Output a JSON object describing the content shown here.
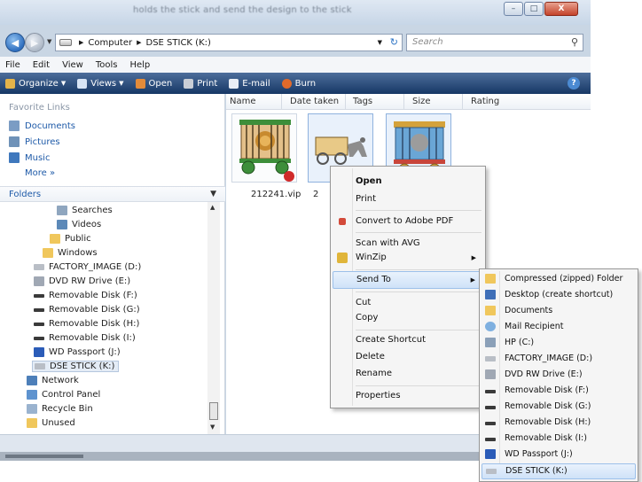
{
  "window": {
    "title": "holds the stick and send the design to the stick",
    "caption_buttons": {
      "minimize": "–",
      "maximize": "□",
      "close": "X"
    }
  },
  "address": {
    "path": [
      "Computer",
      "DSE STICK (K:)"
    ],
    "search_placeholder": "Search"
  },
  "menubar": {
    "items": [
      "File",
      "Edit",
      "View",
      "Tools",
      "Help"
    ]
  },
  "command_bar": {
    "items": [
      {
        "label": "Organize",
        "icon": "organize-icon",
        "dropdown": true
      },
      {
        "label": "Views",
        "icon": "views-icon",
        "dropdown": true
      },
      {
        "label": "Open",
        "icon": "open-icon",
        "dropdown": false
      },
      {
        "label": "Print",
        "icon": "printer-icon",
        "dropdown": false
      },
      {
        "label": "E-mail",
        "icon": "email-icon",
        "dropdown": false
      },
      {
        "label": "Burn",
        "icon": "burn-icon",
        "dropdown": false
      }
    ]
  },
  "nav": {
    "favorites_heading": "Favorite Links",
    "favorites": [
      {
        "label": "Documents",
        "icon": "documents-icon"
      },
      {
        "label": "Pictures",
        "icon": "pictures-icon"
      },
      {
        "label": "Music",
        "icon": "music-icon"
      }
    ],
    "more": "More »",
    "folders_heading": "Folders",
    "tree": [
      {
        "label": "Searches",
        "icon": "searches-icon"
      },
      {
        "label": "Videos",
        "icon": "videos-icon"
      },
      {
        "label": "Public",
        "icon": "folder-icon"
      },
      {
        "label": "Windows",
        "icon": "folder-icon"
      },
      {
        "label": "FACTORY_IMAGE (D:)",
        "icon": "hard-drive-icon"
      },
      {
        "label": "DVD RW Drive (E:)",
        "icon": "dvd-drive-icon"
      },
      {
        "label": "Removable Disk (F:)",
        "icon": "removable-disk-icon"
      },
      {
        "label": "Removable Disk (G:)",
        "icon": "removable-disk-icon"
      },
      {
        "label": "Removable Disk (H:)",
        "icon": "removable-disk-icon"
      },
      {
        "label": "Removable Disk (I:)",
        "icon": "removable-disk-icon"
      },
      {
        "label": "WD Passport (J:)",
        "icon": "wd-passport-icon"
      },
      {
        "label": "DSE STICK (K:)",
        "icon": "usb-drive-icon",
        "selected": true
      },
      {
        "label": "Network",
        "icon": "network-icon"
      },
      {
        "label": "Control Panel",
        "icon": "control-panel-icon"
      },
      {
        "label": "Recycle Bin",
        "icon": "recycle-bin-icon"
      },
      {
        "label": "Unused",
        "icon": "folder-icon"
      }
    ]
  },
  "files": {
    "columns": [
      "Name",
      "Date taken",
      "Tags",
      "Size",
      "Rating"
    ],
    "items": [
      {
        "name": "212241.vip",
        "icon": "circus-cage-lion-thumbnail",
        "selected": false
      },
      {
        "name": "2",
        "icon": "circus-carriage-thumbnail",
        "selected": true
      },
      {
        "name": "",
        "icon": "circus-cage-elephant-thumbnail",
        "selected": true
      }
    ]
  },
  "context_menu": {
    "items": [
      {
        "label": "Open",
        "bold": true
      },
      {
        "label": "Print"
      },
      {
        "label": "Convert to Adobe PDF",
        "icon": "adobe-pdf-icon"
      },
      {
        "label": "Scan with AVG"
      },
      {
        "label": "WinZip",
        "icon": "winzip-icon",
        "submenu": true
      },
      {
        "label": "Send To",
        "submenu": true,
        "highlighted": true
      },
      {
        "label": "Cut"
      },
      {
        "label": "Copy"
      },
      {
        "label": "Create Shortcut"
      },
      {
        "label": "Delete"
      },
      {
        "label": "Rename"
      },
      {
        "label": "Properties"
      }
    ]
  },
  "send_to_menu": {
    "items": [
      {
        "label": "Compressed (zipped) Folder",
        "icon": "zip-folder-icon"
      },
      {
        "label": "Desktop (create shortcut)",
        "icon": "desktop-icon"
      },
      {
        "label": "Documents",
        "icon": "documents-icon"
      },
      {
        "label": "Mail Recipient",
        "icon": "mail-recipient-icon"
      },
      {
        "label": "HP (C:)",
        "icon": "hard-drive-icon"
      },
      {
        "label": "FACTORY_IMAGE (D:)",
        "icon": "hard-drive-icon"
      },
      {
        "label": "DVD RW Drive (E:)",
        "icon": "dvd-drive-icon"
      },
      {
        "label": "Removable Disk (F:)",
        "icon": "removable-disk-icon"
      },
      {
        "label": "Removable Disk (G:)",
        "icon": "removable-disk-icon"
      },
      {
        "label": "Removable Disk (H:)",
        "icon": "removable-disk-icon"
      },
      {
        "label": "Removable Disk (I:)",
        "icon": "removable-disk-icon"
      },
      {
        "label": "WD Passport (J:)",
        "icon": "wd-passport-icon"
      },
      {
        "label": "DSE STICK (K:)",
        "icon": "usb-drive-icon",
        "highlighted": true
      }
    ]
  }
}
